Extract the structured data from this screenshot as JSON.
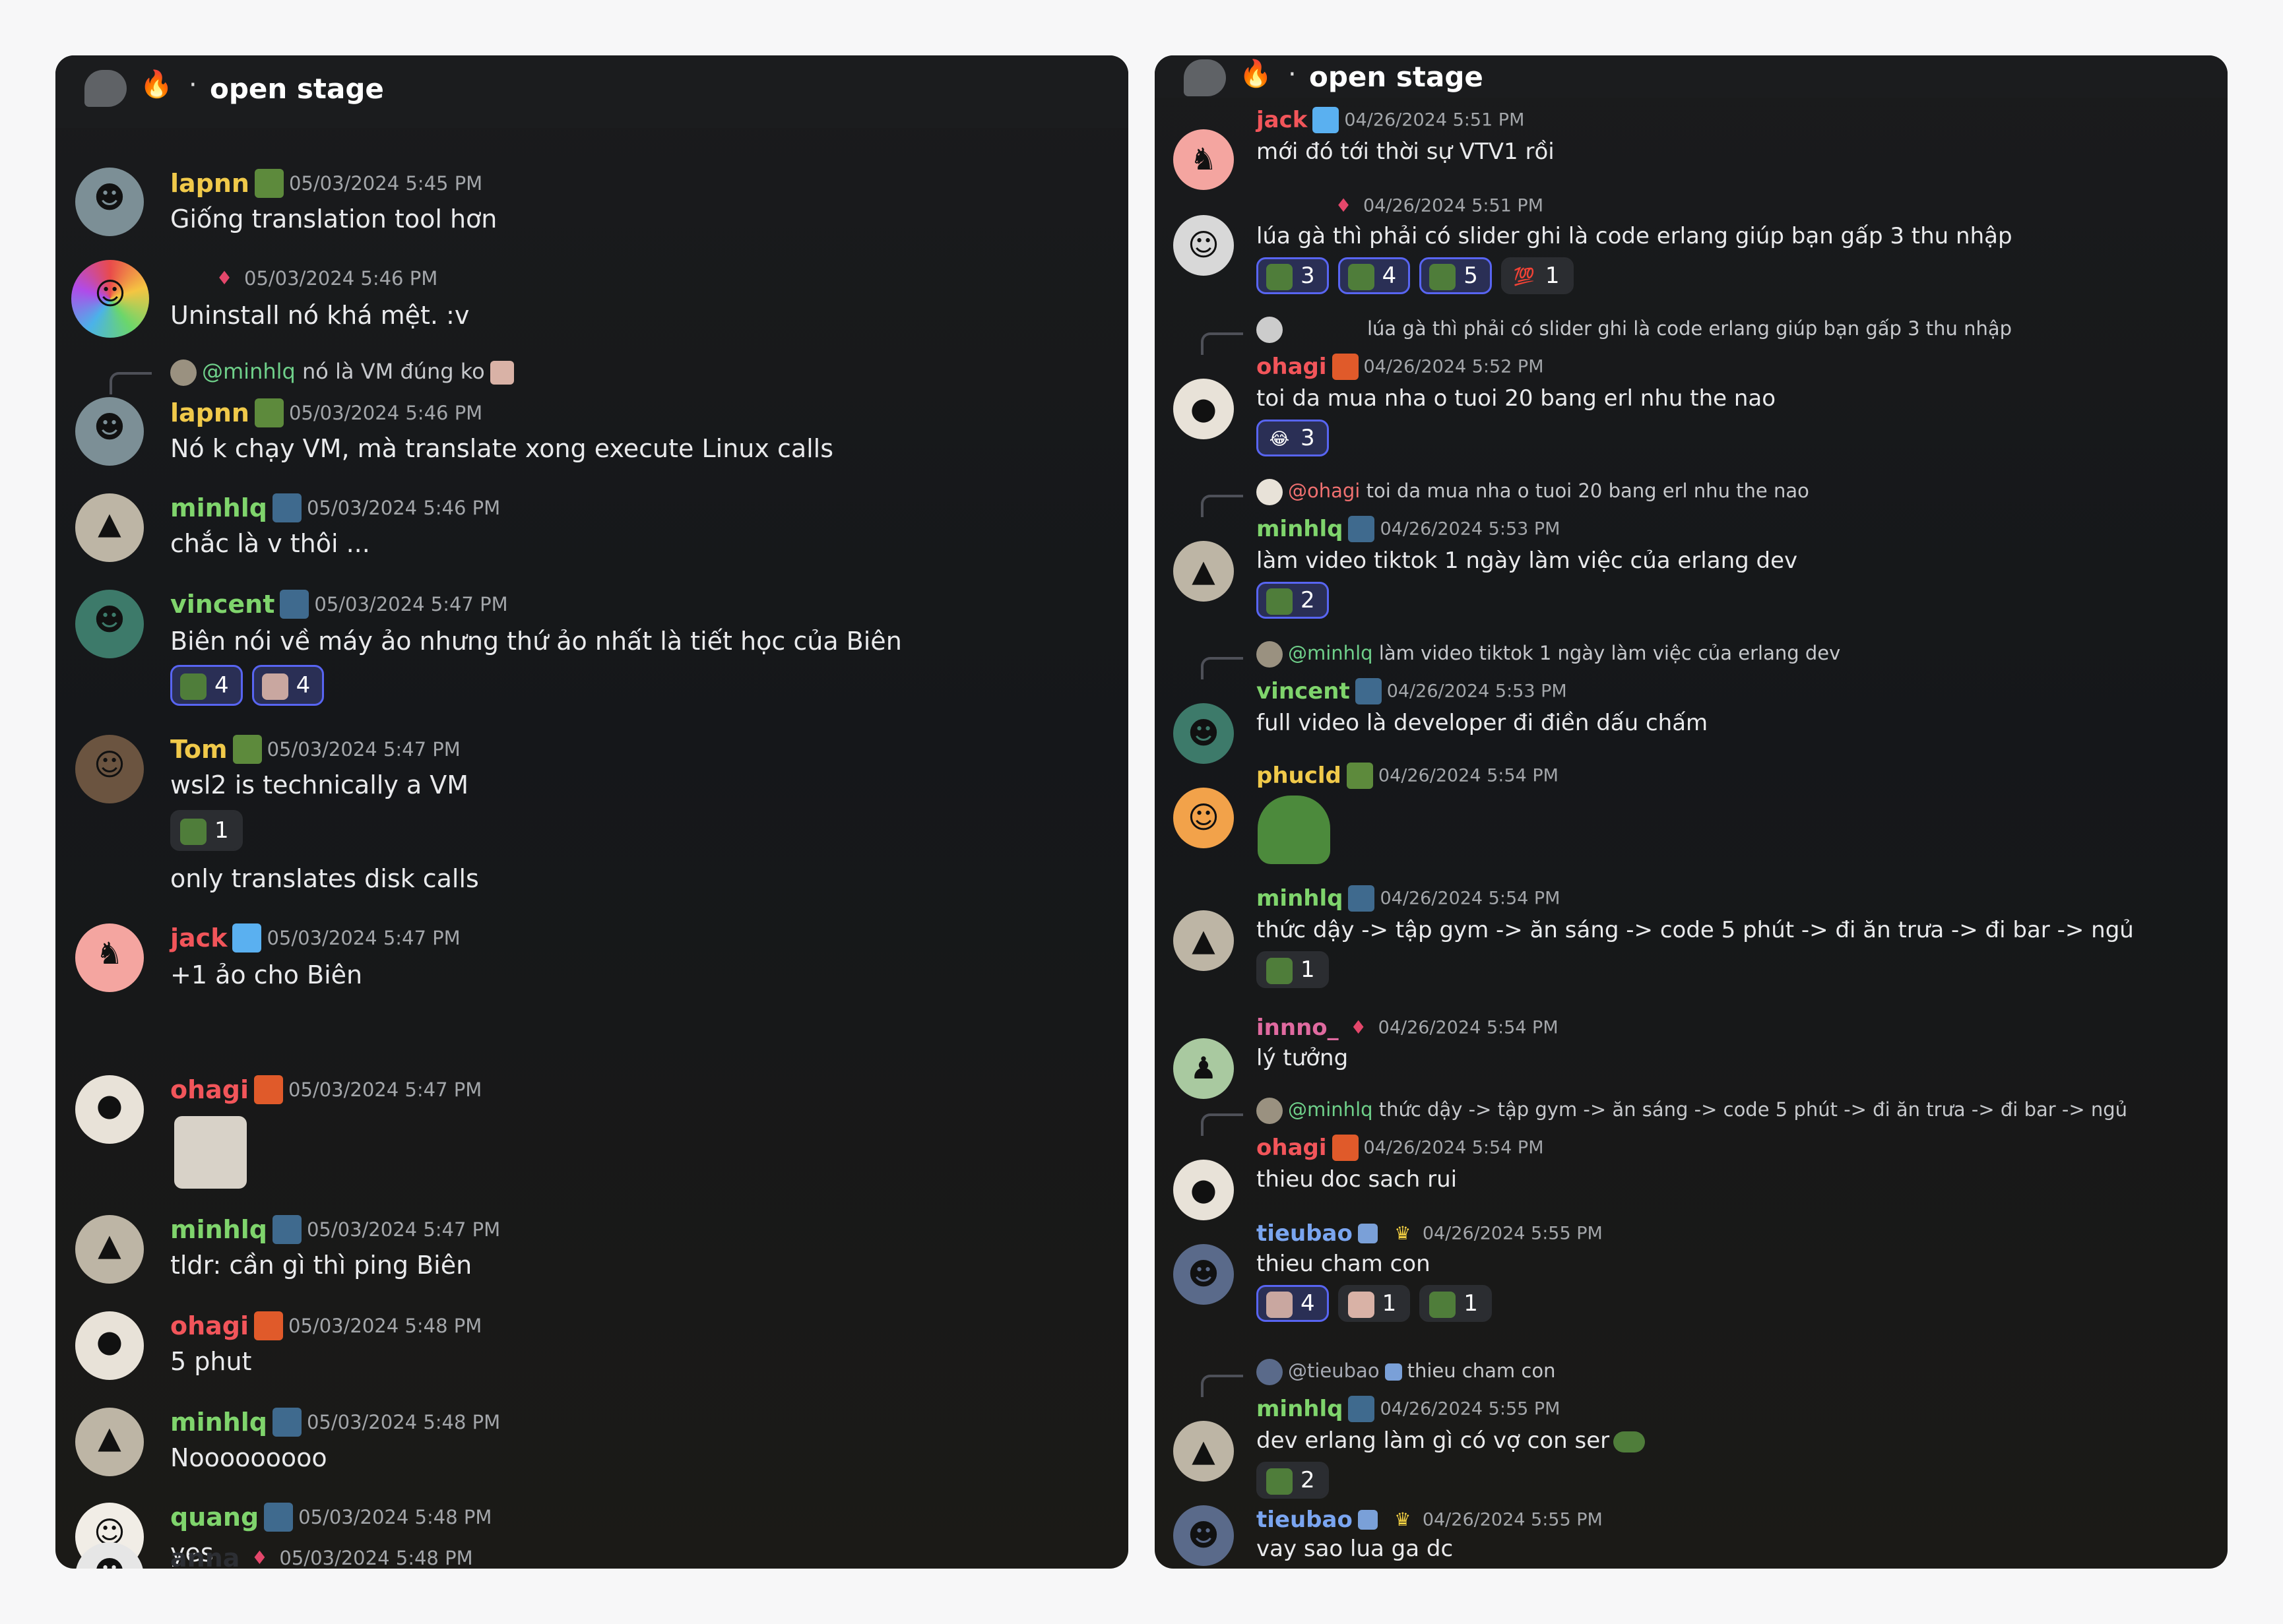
{
  "left": {
    "header": {
      "title": "open stage",
      "fire_icon": "🔥",
      "dot": "·"
    },
    "messages": [
      {
        "user": "lapnn",
        "time": "05/03/2024 5:45 PM",
        "text": "Giống translation tool hơn"
      },
      {
        "user": "",
        "time": "05/03/2024 5:46 PM",
        "text": "Uninstall nó khá mệt. :v"
      },
      {
        "reply_mention": "@minhlq",
        "reply_text": "nó là VM đúng ko",
        "user": "lapnn",
        "time": "05/03/2024 5:46 PM",
        "text": "Nó k chạy VM, mà translate xong execute Linux calls"
      },
      {
        "user": "minhlq",
        "time": "05/03/2024 5:46 PM",
        "text": "chắc là v thôi ..."
      },
      {
        "user": "vincent",
        "time": "05/03/2024 5:47 PM",
        "text": "Biên nói về máy ảo nhưng thứ ảo nhất là tiết học của Biên",
        "reactions": [
          "4",
          "4"
        ]
      },
      {
        "user": "Tom",
        "time": "05/03/2024 5:47 PM",
        "text": "wsl2 is technically a VM",
        "reactions": [
          "1"
        ],
        "text2": "only translates disk calls"
      },
      {
        "user": "jack",
        "time": "05/03/2024 5:47 PM",
        "text": "+1 ảo cho Biên"
      },
      {
        "user": "ohagi",
        "time": "05/03/2024 5:47 PM"
      },
      {
        "user": "minhlq",
        "time": "05/03/2024 5:47 PM",
        "text": "tldr: cần gì thì ping Biên"
      },
      {
        "user": "ohagi",
        "time": "05/03/2024 5:48 PM",
        "text": "5 phut"
      },
      {
        "user": "minhlq",
        "time": "05/03/2024 5:48 PM",
        "text": "Nooooooooo"
      },
      {
        "user": "quang",
        "time": "05/03/2024 5:48 PM",
        "text": "yes"
      },
      {
        "user": "anna",
        "time": "05/03/2024 5:48 PM"
      }
    ]
  },
  "right": {
    "header": {
      "title": "open stage",
      "fire_icon": "🔥",
      "dot": "·"
    },
    "messages": [
      {
        "user": "jack",
        "time": "04/26/2024 5:51 PM",
        "text": "mới đó tới thời sự VTV1 rồi"
      },
      {
        "user": "",
        "time": "04/26/2024 5:51 PM",
        "text": "lúa gà thì phải có slider ghi là code erlang giúp bạn gấp 3 thu nhập",
        "reactions": [
          "3",
          "4",
          "5",
          "1"
        ]
      },
      {
        "reply_mention": "",
        "reply_text": "lúa gà thì phải có slider ghi là code erlang giúp bạn gấp 3 thu nhập",
        "user": "ohagi",
        "time": "04/26/2024 5:52 PM",
        "text": "toi da mua nha o tuoi 20 bang erl nhu the nao",
        "reactions": [
          "3"
        ]
      },
      {
        "reply_mention": "@ohagi",
        "reply_text": "toi da mua nha o tuoi 20 bang erl nhu the nao",
        "user": "minhlq",
        "time": "04/26/2024 5:53 PM",
        "text": "làm video tiktok 1 ngày làm việc của erlang dev",
        "reactions": [
          "2"
        ]
      },
      {
        "reply_mention": "@minhlq",
        "reply_text": "làm video tiktok 1 ngày làm việc của erlang dev",
        "user": "vincent",
        "time": "04/26/2024 5:53 PM",
        "text": "full video là developer đi điền dấu chấm"
      },
      {
        "user": "phucld",
        "time": "04/26/2024 5:54 PM"
      },
      {
        "user": "minhlq",
        "time": "04/26/2024 5:54 PM",
        "text": "thức dậy -> tập gym -> ăn sáng -> code 5 phút -> đi ăn trưa -> đi bar -> ngủ",
        "reactions": [
          "1"
        ]
      },
      {
        "user": "innno_",
        "time": "04/26/2024 5:54 PM",
        "text": "lý tưởng"
      },
      {
        "reply_mention": "@minhlq",
        "reply_text": "thức dậy -> tập gym -> ăn sáng -> code 5 phút -> đi ăn trưa -> đi bar -> ngủ",
        "user": "ohagi",
        "time": "04/26/2024 5:54 PM",
        "text": "thieu doc sach rui"
      },
      {
        "user": "tieubao",
        "time": "04/26/2024 5:55 PM",
        "text": "thieu cham con",
        "reactions": [
          "4",
          "1",
          "1"
        ]
      },
      {
        "reply_mention": "@tieubao",
        "reply_text": "thieu cham con",
        "user": "minhlq",
        "time": "04/26/2024 5:55 PM",
        "text": "dev erlang làm gì có vợ con ser",
        "reactions": [
          "2"
        ]
      },
      {
        "user": "tieubao",
        "time": "04/26/2024 5:55 PM",
        "text": "vay sao lua ga dc"
      }
    ]
  },
  "colors": {
    "accent": "#5865f2",
    "reaction_bg": "#2a2f55",
    "text": "#e9eaec",
    "timestamp": "#a3a6aa"
  }
}
